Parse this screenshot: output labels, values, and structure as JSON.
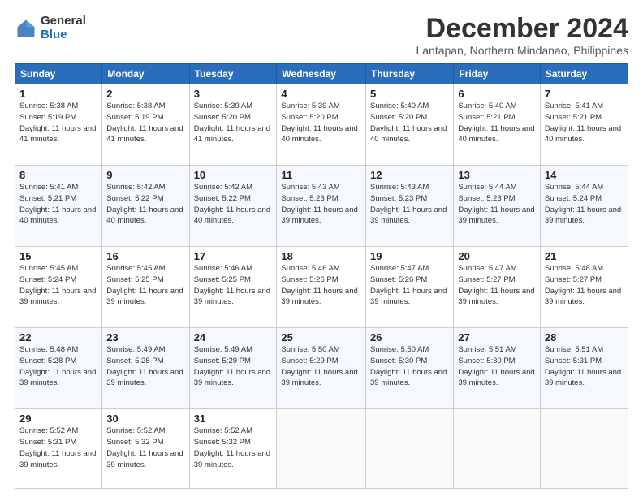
{
  "logo": {
    "general": "General",
    "blue": "Blue"
  },
  "header": {
    "month": "December 2024",
    "location": "Lantapan, Northern Mindanao, Philippines"
  },
  "weekdays": [
    "Sunday",
    "Monday",
    "Tuesday",
    "Wednesday",
    "Thursday",
    "Friday",
    "Saturday"
  ],
  "weeks": [
    [
      {
        "day": 1,
        "sunrise": "5:38 AM",
        "sunset": "5:19 PM",
        "daylight": "11 hours and 41 minutes."
      },
      {
        "day": 2,
        "sunrise": "5:38 AM",
        "sunset": "5:19 PM",
        "daylight": "11 hours and 41 minutes."
      },
      {
        "day": 3,
        "sunrise": "5:39 AM",
        "sunset": "5:20 PM",
        "daylight": "11 hours and 41 minutes."
      },
      {
        "day": 4,
        "sunrise": "5:39 AM",
        "sunset": "5:20 PM",
        "daylight": "11 hours and 40 minutes."
      },
      {
        "day": 5,
        "sunrise": "5:40 AM",
        "sunset": "5:20 PM",
        "daylight": "11 hours and 40 minutes."
      },
      {
        "day": 6,
        "sunrise": "5:40 AM",
        "sunset": "5:21 PM",
        "daylight": "11 hours and 40 minutes."
      },
      {
        "day": 7,
        "sunrise": "5:41 AM",
        "sunset": "5:21 PM",
        "daylight": "11 hours and 40 minutes."
      }
    ],
    [
      {
        "day": 8,
        "sunrise": "5:41 AM",
        "sunset": "5:21 PM",
        "daylight": "11 hours and 40 minutes."
      },
      {
        "day": 9,
        "sunrise": "5:42 AM",
        "sunset": "5:22 PM",
        "daylight": "11 hours and 40 minutes."
      },
      {
        "day": 10,
        "sunrise": "5:42 AM",
        "sunset": "5:22 PM",
        "daylight": "11 hours and 40 minutes."
      },
      {
        "day": 11,
        "sunrise": "5:43 AM",
        "sunset": "5:23 PM",
        "daylight": "11 hours and 39 minutes."
      },
      {
        "day": 12,
        "sunrise": "5:43 AM",
        "sunset": "5:23 PM",
        "daylight": "11 hours and 39 minutes."
      },
      {
        "day": 13,
        "sunrise": "5:44 AM",
        "sunset": "5:23 PM",
        "daylight": "11 hours and 39 minutes."
      },
      {
        "day": 14,
        "sunrise": "5:44 AM",
        "sunset": "5:24 PM",
        "daylight": "11 hours and 39 minutes."
      }
    ],
    [
      {
        "day": 15,
        "sunrise": "5:45 AM",
        "sunset": "5:24 PM",
        "daylight": "11 hours and 39 minutes."
      },
      {
        "day": 16,
        "sunrise": "5:45 AM",
        "sunset": "5:25 PM",
        "daylight": "11 hours and 39 minutes."
      },
      {
        "day": 17,
        "sunrise": "5:46 AM",
        "sunset": "5:25 PM",
        "daylight": "11 hours and 39 minutes."
      },
      {
        "day": 18,
        "sunrise": "5:46 AM",
        "sunset": "5:26 PM",
        "daylight": "11 hours and 39 minutes."
      },
      {
        "day": 19,
        "sunrise": "5:47 AM",
        "sunset": "5:26 PM",
        "daylight": "11 hours and 39 minutes."
      },
      {
        "day": 20,
        "sunrise": "5:47 AM",
        "sunset": "5:27 PM",
        "daylight": "11 hours and 39 minutes."
      },
      {
        "day": 21,
        "sunrise": "5:48 AM",
        "sunset": "5:27 PM",
        "daylight": "11 hours and 39 minutes."
      }
    ],
    [
      {
        "day": 22,
        "sunrise": "5:48 AM",
        "sunset": "5:28 PM",
        "daylight": "11 hours and 39 minutes."
      },
      {
        "day": 23,
        "sunrise": "5:49 AM",
        "sunset": "5:28 PM",
        "daylight": "11 hours and 39 minutes."
      },
      {
        "day": 24,
        "sunrise": "5:49 AM",
        "sunset": "5:29 PM",
        "daylight": "11 hours and 39 minutes."
      },
      {
        "day": 25,
        "sunrise": "5:50 AM",
        "sunset": "5:29 PM",
        "daylight": "11 hours and 39 minutes."
      },
      {
        "day": 26,
        "sunrise": "5:50 AM",
        "sunset": "5:30 PM",
        "daylight": "11 hours and 39 minutes."
      },
      {
        "day": 27,
        "sunrise": "5:51 AM",
        "sunset": "5:30 PM",
        "daylight": "11 hours and 39 minutes."
      },
      {
        "day": 28,
        "sunrise": "5:51 AM",
        "sunset": "5:31 PM",
        "daylight": "11 hours and 39 minutes."
      }
    ],
    [
      {
        "day": 29,
        "sunrise": "5:52 AM",
        "sunset": "5:31 PM",
        "daylight": "11 hours and 39 minutes."
      },
      {
        "day": 30,
        "sunrise": "5:52 AM",
        "sunset": "5:32 PM",
        "daylight": "11 hours and 39 minutes."
      },
      {
        "day": 31,
        "sunrise": "5:52 AM",
        "sunset": "5:32 PM",
        "daylight": "11 hours and 39 minutes."
      },
      null,
      null,
      null,
      null
    ]
  ]
}
